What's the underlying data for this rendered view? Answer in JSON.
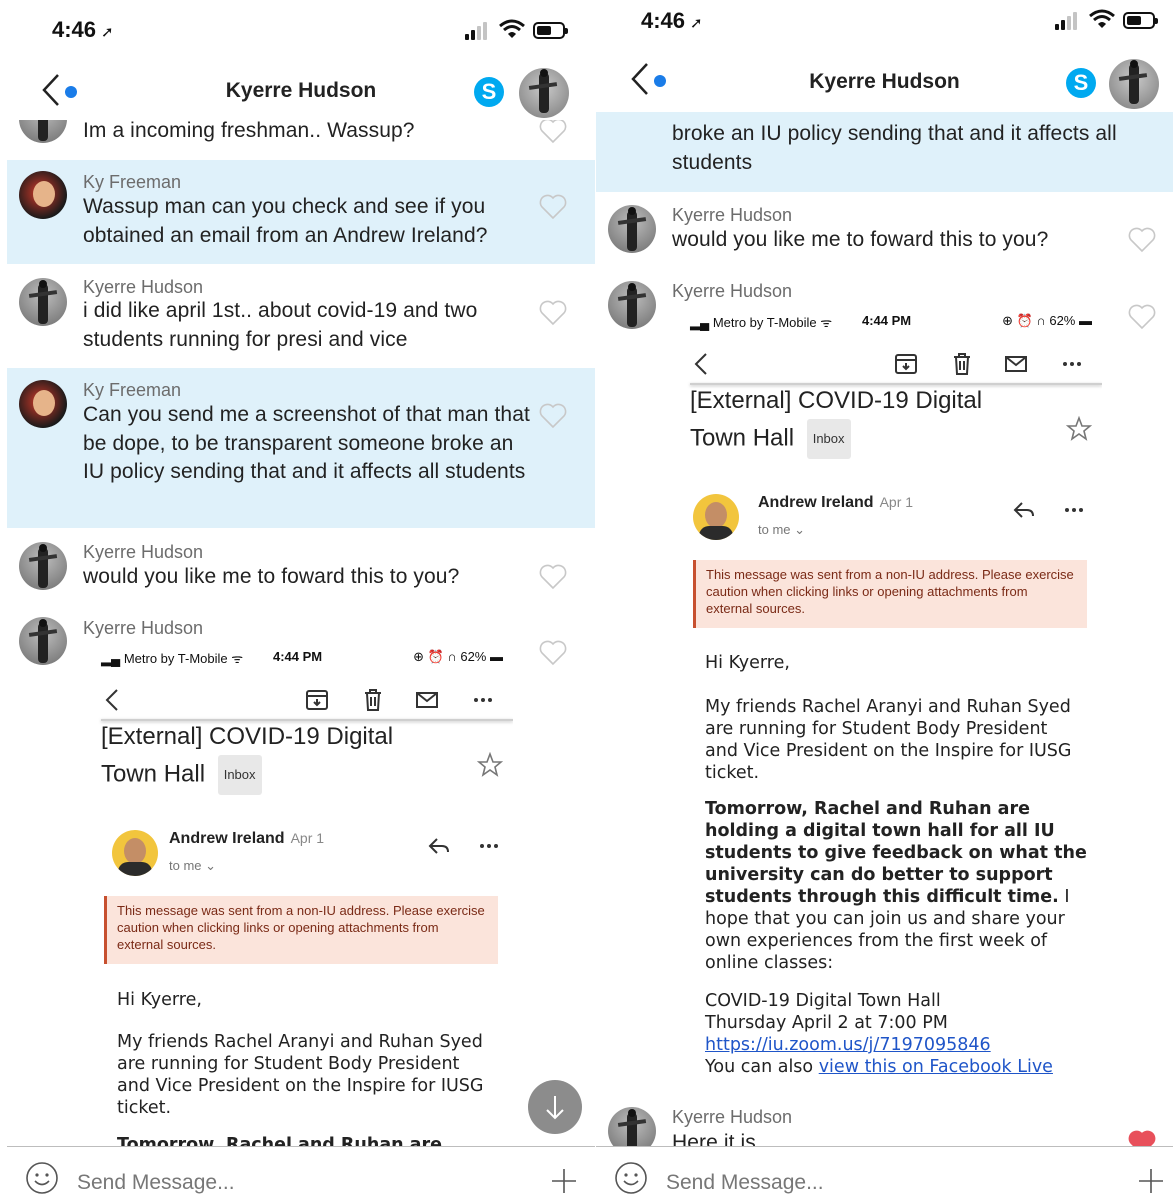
{
  "status": {
    "time": "4:46"
  },
  "header": {
    "title": "Kyerre Hudson",
    "skype_glyph": "S"
  },
  "left": {
    "messages": [
      {
        "sender": "",
        "text": "Im a incoming freshman.. Wassup?"
      },
      {
        "sender": "Ky Freeman",
        "text": "Wassup man can you check and see if you obtained an email from an Andrew Ireland?"
      },
      {
        "sender": "Kyerre Hudson",
        "text": "i did like april 1st.. about covid-19 and two students running for presi and vice"
      },
      {
        "sender": "Ky Freeman",
        "text": "Can you send me a screenshot of that man that be dope, to be transparent someone broke an IU policy sending that and it affects all students"
      },
      {
        "sender": "Kyerre Hudson",
        "text": "would you like me to foward this to you?"
      },
      {
        "sender": "Kyerre Hudson",
        "text": ""
      }
    ]
  },
  "right": {
    "messages": [
      {
        "sender": "",
        "text": "broke an IU policy sending that and it affects all students"
      },
      {
        "sender": "Kyerre Hudson",
        "text": "would you like me to foward this to you?"
      },
      {
        "sender": "Kyerre Hudson",
        "text": ""
      },
      {
        "sender": "Kyerre Hudson",
        "text": "Here it is"
      }
    ]
  },
  "email": {
    "status_carrier": "Metro by T-Mobile",
    "status_time": "4:44 PM",
    "status_battery": "62%",
    "subject_line1": "[External] COVID-19 Digital",
    "subject_line2": "Town Hall",
    "inbox_badge": "Inbox",
    "sender_name": "Andrew Ireland",
    "sender_date": "Apr 1",
    "to_me": "to me ⌄",
    "warning": "This message was sent from a non-IU address. Please exercise caution when clicking links or opening attachments from external sources.",
    "greeting": "Hi Kyerre,",
    "para1": "My friends Rachel Aranyi and Ruhan Syed are running for Student Body President and Vice President on the Inspire for IUSG ticket.",
    "para2_bold": "Tomorrow, Rachel and Ruhan are holding a digital town hall for all IU students to give feedback on what the university can do better to support students through this difficult time.",
    "para2_rest": " I hope that you can join us and share your own experiences from the first week of online classes:",
    "event_name": "COVID-19 Digital Town Hall",
    "event_time": "Thursday April 2 at 7:00 PM",
    "event_link": "https://iu.zoom.us/j/7197095846",
    "also_prefix": "You can also ",
    "also_link": "view this on Facebook Live"
  },
  "composer": {
    "placeholder": "Send Message..."
  },
  "colors": {
    "highlight": "#dff1fa",
    "accent": "#1a7ce8",
    "skype": "#00a9f0",
    "liked_heart": "#e8505b"
  }
}
